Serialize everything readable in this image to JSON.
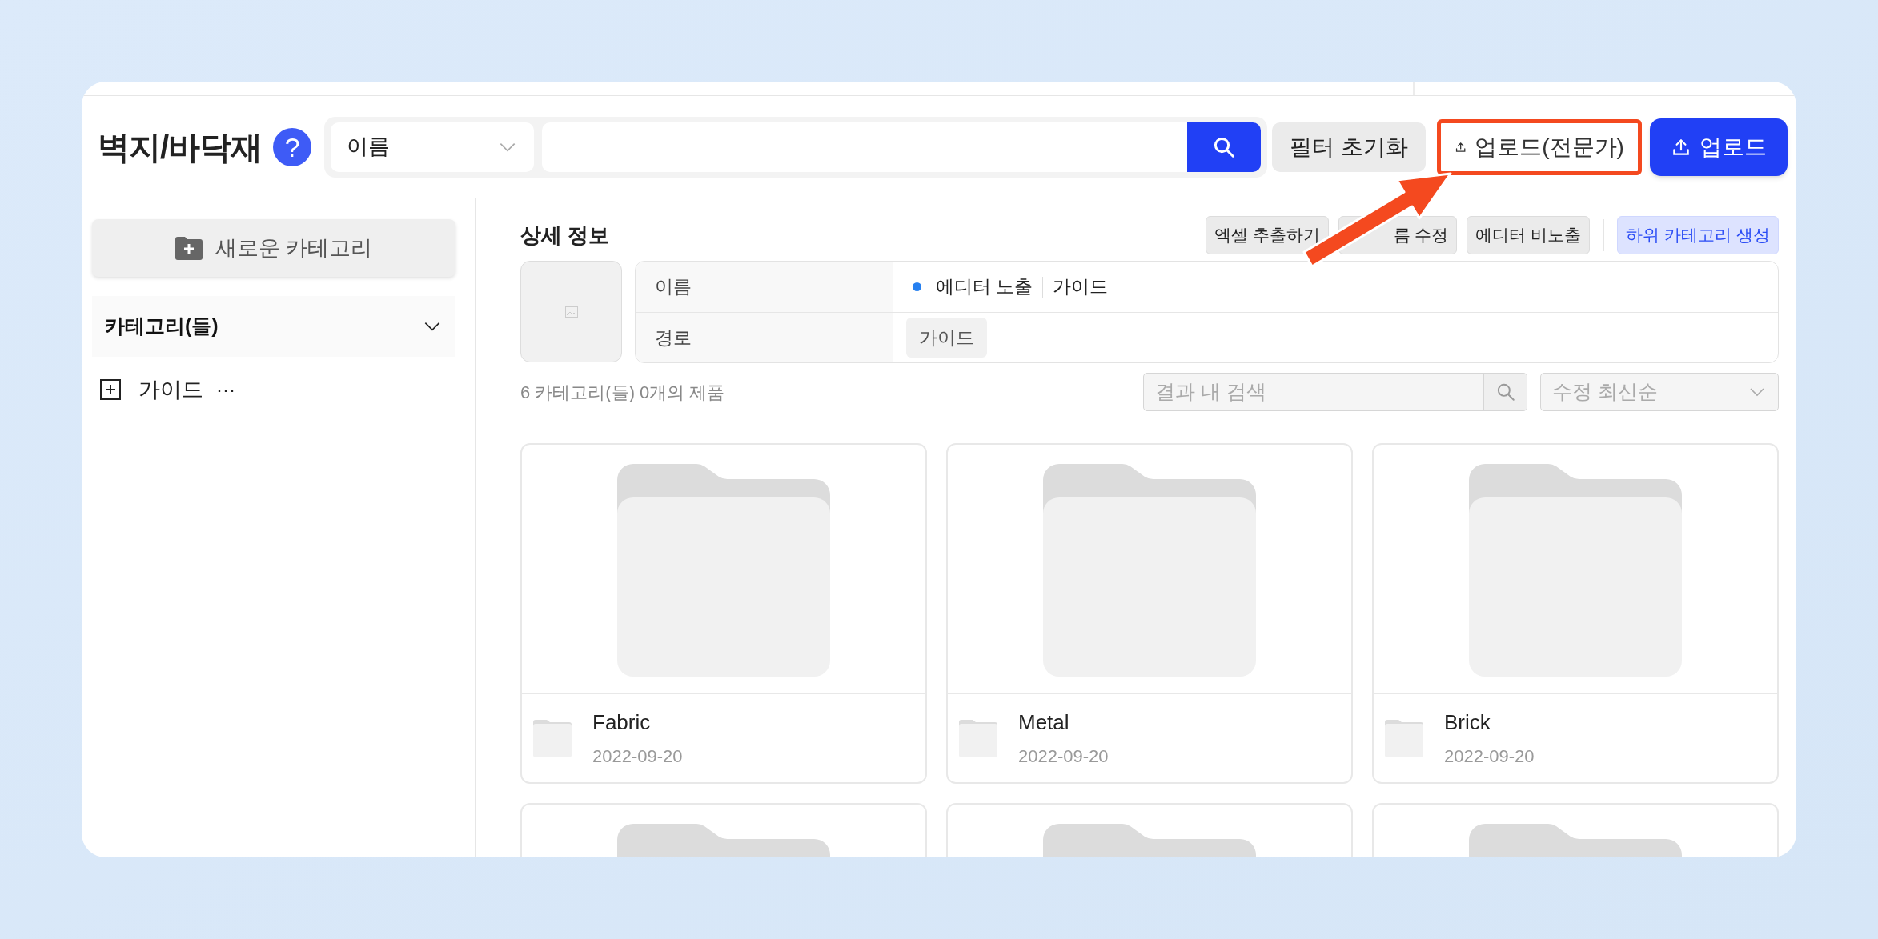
{
  "header": {
    "title": "벽지/바닥재",
    "help": "?",
    "search": {
      "field": "이름",
      "buttons": [
        {
          "label": "필터 초기화",
          "kind": "plain"
        },
        {
          "label": "업로드(전문가)",
          "kind": "outline",
          "highlighted": true
        },
        {
          "label": "업로드",
          "kind": "primary",
          "highlighted": false
        }
      ]
    }
  },
  "sidebar": {
    "new_button": "새로운 카테고리",
    "section": {
      "title": "카테고리(들)",
      "expanded": true
    },
    "items": [
      {
        "label": "가이드",
        "more": "···",
        "expanded": false
      }
    ]
  },
  "detail": {
    "title": "상세 정보",
    "actions": [
      {
        "label": "엑셀 추출하기",
        "kind": "plain"
      },
      {
        "label": "름 수정",
        "kind": "covered"
      },
      {
        "label": "에디터 비노출",
        "kind": "plain"
      },
      {
        "label": "하위 카테고리 생성",
        "kind": "accent"
      }
    ],
    "rows": [
      {
        "kind": "status",
        "label": "이름",
        "status": "에디터 노출",
        "color": "#2680f0",
        "value": "가이드"
      },
      {
        "kind": "chips",
        "label": "경로",
        "chips": [
          "가이드"
        ]
      }
    ]
  },
  "results": {
    "count": "6 카테고리(들) 0개의 제품",
    "search_placeholder": "결과 내 검색",
    "sort": "수정 최신순"
  },
  "cards": [
    {
      "kind": "full",
      "name": "Fabric",
      "date": "2022-09-20"
    },
    {
      "kind": "full",
      "name": "Metal",
      "date": "2022-09-20"
    },
    {
      "kind": "full",
      "name": "Brick",
      "date": "2022-09-20"
    },
    {
      "kind": "cut"
    },
    {
      "kind": "cut"
    },
    {
      "kind": "cut"
    }
  ]
}
